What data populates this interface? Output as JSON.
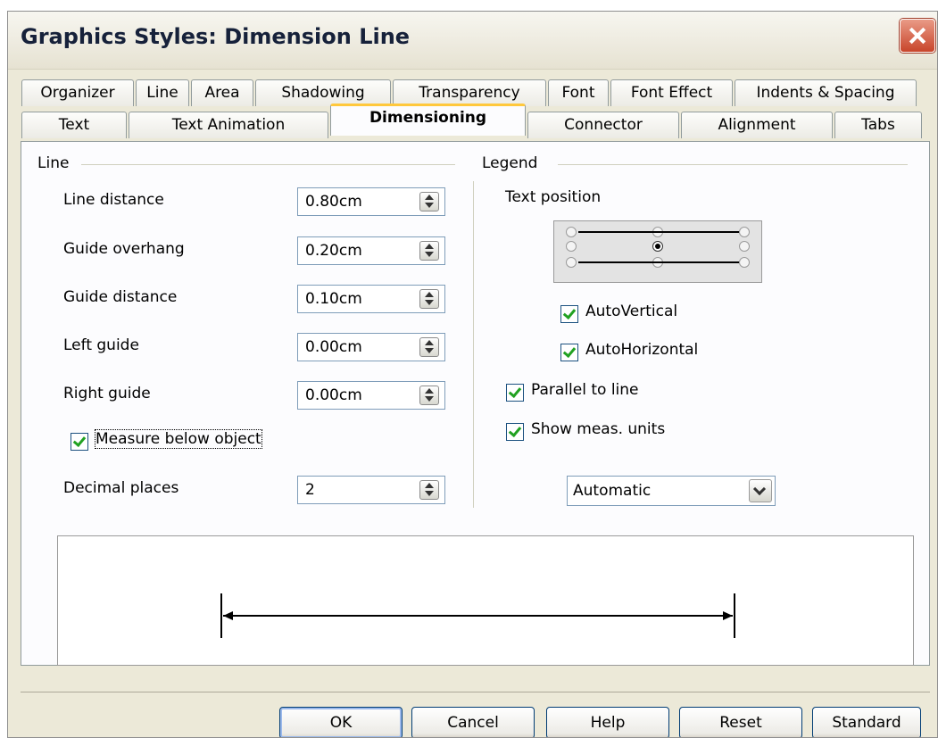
{
  "window": {
    "title": "Graphics Styles: Dimension Line"
  },
  "tabs_row1": [
    "Organizer",
    "Line",
    "Area",
    "Shadowing",
    "Transparency",
    "Font",
    "Font Effect",
    "Indents & Spacing"
  ],
  "tabs_row2": [
    "Text",
    "Text Animation",
    "Dimensioning",
    "Connector",
    "Alignment",
    "Tabs"
  ],
  "active_tab": "Dimensioning",
  "line_group": {
    "label": "Line",
    "fields": [
      {
        "label": "Line distance",
        "value": "0.80cm"
      },
      {
        "label": "Guide overhang",
        "value": "0.20cm"
      },
      {
        "label": "Guide distance",
        "value": "0.10cm"
      },
      {
        "label": "Left guide",
        "value": "0.00cm"
      },
      {
        "label": "Right guide",
        "value": "0.00cm"
      }
    ],
    "measure_below": {
      "label": "Measure below object",
      "checked": true
    },
    "decimal_places": {
      "label": "Decimal places",
      "value": "2"
    }
  },
  "legend_group": {
    "label": "Legend",
    "text_position_label": "Text position",
    "text_position_selected": "center",
    "auto_vertical": {
      "label": "AutoVertical",
      "checked": true
    },
    "auto_horizontal": {
      "label": "AutoHorizontal",
      "checked": true
    },
    "parallel": {
      "label": "Parallel to line",
      "checked": true
    },
    "show_units": {
      "label": "Show meas. units",
      "checked": true
    },
    "units_select": "Automatic"
  },
  "buttons": {
    "ok": "OK",
    "cancel": "Cancel",
    "help": "Help",
    "reset": "Reset",
    "standard": "Standard"
  },
  "icons": [
    "close-icon",
    "spin-arrows-icon",
    "dropdown-arrow-icon",
    "checkmark-icon"
  ],
  "colors": {
    "dialog_bg": "#ECE9D8",
    "panel_bg": "#FCFCFE",
    "active_tab_accent": "#FFC83C",
    "close_button": "#C8452B",
    "check_mark": "#21A121"
  }
}
